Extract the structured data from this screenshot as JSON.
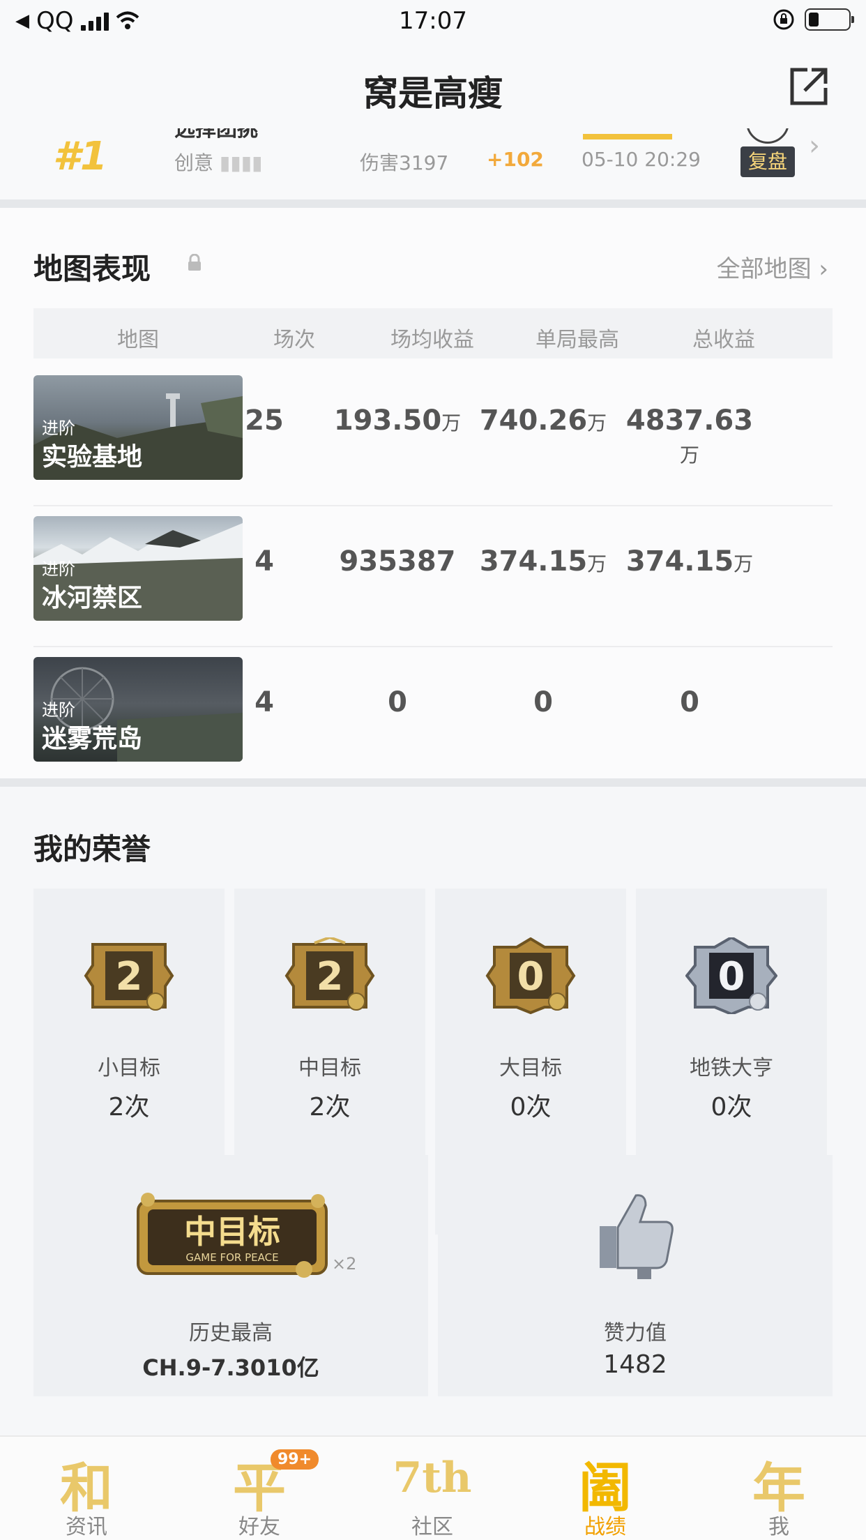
{
  "status_bar": {
    "carrier": "QQ",
    "time": "17:07"
  },
  "nav": {
    "title": "窝是高瘦"
  },
  "recent_match": {
    "rank": "#1",
    "mode_partial": "选择团挑",
    "mode": "创意",
    "damage": "伤害3197",
    "score_change": "+102",
    "datetime": "05-10 20:29",
    "replay_label": "复盘"
  },
  "map_section": {
    "title": "地图表现",
    "all_maps_label": "全部地图",
    "columns": [
      "地图",
      "场次",
      "场均收益",
      "单局最高",
      "总收益"
    ],
    "rows": [
      {
        "tag": "进阶",
        "name": "实验基地",
        "games": "25",
        "avg": "193.50",
        "avg_unit": "万",
        "best": "740.26",
        "best_unit": "万",
        "total": "4837.63",
        "total_unit": "万"
      },
      {
        "tag": "进阶",
        "name": "冰河禁区",
        "games": "4",
        "avg": "935387",
        "avg_unit": "",
        "best": "374.15",
        "best_unit": "万",
        "total": "374.15",
        "total_unit": "万"
      },
      {
        "tag": "进阶",
        "name": "迷雾荒岛",
        "games": "4",
        "avg": "0",
        "avg_unit": "",
        "best": "0",
        "best_unit": "",
        "total": "0",
        "total_unit": ""
      }
    ]
  },
  "honor_section": {
    "title": "我的荣誉",
    "badges": [
      {
        "badge_num": "2",
        "label": "小目标",
        "value": "2次",
        "style": "gold"
      },
      {
        "badge_num": "2",
        "label": "中目标",
        "value": "2次",
        "style": "gold"
      },
      {
        "badge_num": "0",
        "label": "大目标",
        "value": "0次",
        "style": "gold"
      },
      {
        "badge_num": "0",
        "label": "地铁大亨",
        "value": "0次",
        "style": "silver"
      }
    ],
    "history": {
      "plaque_text": "中目标",
      "plaque_sub": "GAME FOR PEACE",
      "multiplier": "×2",
      "label": "历史最高",
      "value": "CH.9-7.3010亿"
    },
    "likes": {
      "label": "赞力值",
      "value": "1482"
    }
  },
  "tabbar": {
    "tabs": [
      {
        "glyph": "和",
        "label": "资讯",
        "active": false
      },
      {
        "glyph": "平",
        "label": "好友",
        "active": false,
        "badge": "99+"
      },
      {
        "glyph": "7th",
        "label": "社区",
        "active": false
      },
      {
        "glyph": "阖",
        "label": "战绩",
        "active": true
      },
      {
        "glyph": "年",
        "label": "我",
        "active": false
      }
    ]
  },
  "colors": {
    "accent": "#f2b800",
    "rank_gold": "#f2c23c",
    "score_orange": "#f2a93b"
  }
}
